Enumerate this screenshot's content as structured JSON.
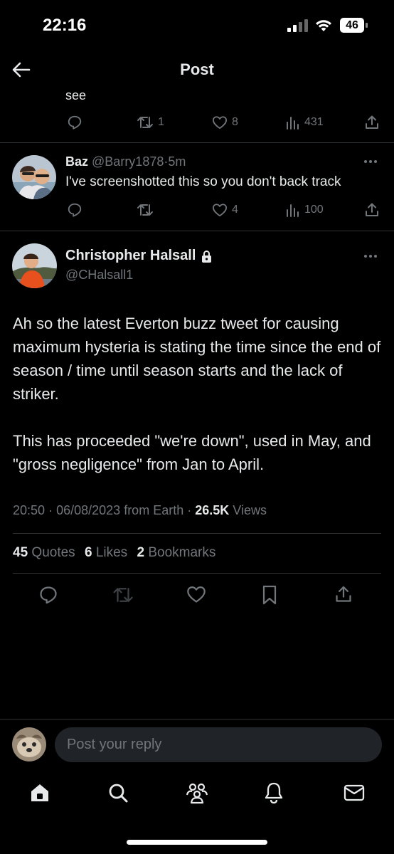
{
  "status": {
    "time": "22:16",
    "battery": "46"
  },
  "header": {
    "title": "Post"
  },
  "reply1": {
    "text_tail": "see",
    "retweets": "1",
    "likes": "8",
    "views": "431"
  },
  "reply2": {
    "name": "Baz",
    "handle": "@Barry1878",
    "time": "5m",
    "text": "I've screenshotted this so you don't back track",
    "likes": "4",
    "views": "100"
  },
  "tweet": {
    "name": "Christopher Halsall",
    "handle": "@CHalsall1",
    "paragraphs": [
      "Ah so the latest Everton buzz tweet for causing maximum hysteria is stating the time since the end of season / time until season starts and the lack of striker.",
      "This has proceeded \"we're down\", used in May, and \"gross negligence\" from Jan to April."
    ],
    "time": "20:50",
    "date": "06/08/2023",
    "source": "from Earth",
    "views_count": "26.5K",
    "views_label": "Views",
    "quotes_count": "45",
    "quotes_label": "Quotes",
    "likes_count": "6",
    "likes_label": "Likes",
    "bookmarks_count": "2",
    "bookmarks_label": "Bookmarks"
  },
  "reply_box": {
    "placeholder": "Post your reply"
  },
  "colors": {
    "background": "#000000",
    "muted": "#71767b",
    "text": "#e7e9ea",
    "divider": "#2f3336"
  }
}
